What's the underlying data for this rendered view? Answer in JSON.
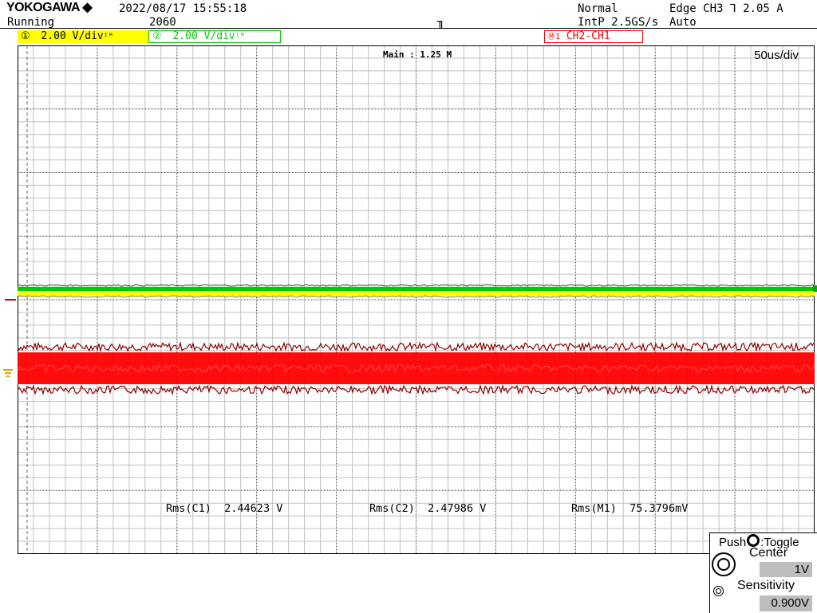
{
  "header": {
    "brand": "YOKOGAWA",
    "brand_icon": "diamond-icon",
    "datetime": "2022/08/17 15:55:18",
    "status": "Running",
    "acq_count": "2060",
    "trigger_mode": "Normal",
    "sample_rate": "IntP 2.5GS/s",
    "trigger_source": "Edge CH3",
    "trigger_level": "2.05 A",
    "trigger_auto": "Auto"
  },
  "channels": [
    {
      "num": "①",
      "label": "2.00 V/div",
      "suffix": "ᴵᴹ",
      "color": "#ffff00"
    },
    {
      "num": "②",
      "label": "2.00 V/div",
      "suffix": "ᴵᴹ",
      "color": "#00cc00"
    }
  ],
  "math": {
    "num": "Ⓜ1",
    "label": "CH2-CH1",
    "color": "#ff0000"
  },
  "screen": {
    "zoom_label": "Main : 1.25 M",
    "timebase": "50us/div"
  },
  "measurements": [
    {
      "name": "Rms(C1)",
      "value": "2.44623 V"
    },
    {
      "name": "Rms(C2)",
      "value": "2.47986 V"
    },
    {
      "name": "Rms(M1)",
      "value": "75.3796mV"
    }
  ],
  "panel": {
    "title": "Push",
    "title2": ":Toggle",
    "center_label": "Center",
    "center_value": "1V",
    "sensitivity_label": "Sensitivity",
    "sensitivity_value": "0.900V"
  },
  "colors": {
    "ch1": "#ffff00",
    "ch2": "#00cc00",
    "math": "#ff0000",
    "math_dark": "#8b0000"
  }
}
